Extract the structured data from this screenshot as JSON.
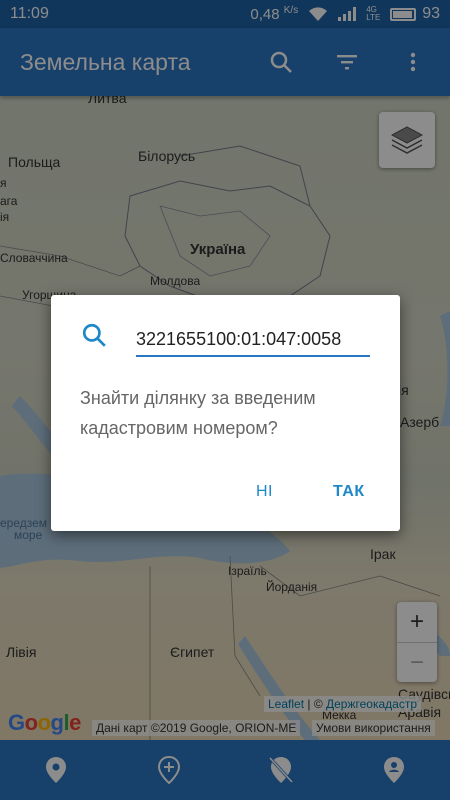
{
  "status_bar": {
    "time": "11:09",
    "net_speed": "0,48",
    "net_unit": "K/s",
    "lte_label": "4G LTE",
    "battery": "93"
  },
  "app_bar": {
    "title": "Земельна карта",
    "icons": [
      "search-icon",
      "filter-icon",
      "more-vert-icon"
    ]
  },
  "map": {
    "labels": {
      "lithuania": "Литва",
      "poland": "Польща",
      "belarus": "Білорусь",
      "ukraine": "Україна",
      "slovakia": "Словаччина",
      "moldova": "Молдова",
      "hungary": "Угорщина",
      "cut_left_1": "я",
      "cut_left_2": "ага",
      "cut_left_3": "ія",
      "cut_right_1": "ія",
      "azerbaijan_cut": "Азерб",
      "sea_cut_1": "ередзем",
      "sea_cut_2": "море",
      "iraq": "Ірак",
      "israel": "Ізраїль",
      "jordan": "Йорданія",
      "libya": "Лівія",
      "egypt": "Єгипет",
      "saudi_cut": "Саудівсь",
      "mecca": "Мекка",
      "arabia": "Аравія"
    },
    "zoom_in": "+",
    "zoom_out": "−",
    "attribution_leaflet": "Leaflet",
    "attribution_sep": " | © ",
    "attribution_source": "Держгеокадастр",
    "google_logo": [
      "G",
      "o",
      "o",
      "g",
      "l",
      "e"
    ],
    "google_data": "Дані карт ©2019 Google, ORION-ME",
    "google_terms": "Умови використання"
  },
  "dialog": {
    "input_value": "3221655100:01:047:0058",
    "message": "Знайти ділянку за введеним кадастровим номером?",
    "no_label": "НІ",
    "yes_label": "ТАК",
    "accent_color": "#1e88c8"
  },
  "bottom_nav": {
    "items": [
      "place-icon",
      "add-place-icon",
      "place-off-icon",
      "person-pin-icon"
    ]
  },
  "colors": {
    "status_bar": "#1e63a8",
    "app_bar": "#2a76c2"
  }
}
